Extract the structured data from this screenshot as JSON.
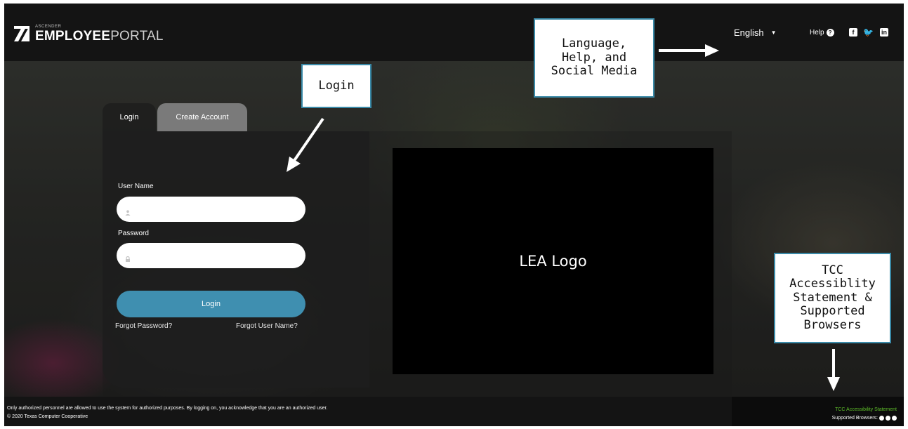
{
  "header": {
    "logo_small": "ASCENDER",
    "logo_bold": "EMPLOYEE",
    "logo_light": "PORTAL",
    "language": "English",
    "help": "Help",
    "social_icons": [
      "facebook-icon",
      "twitter-icon",
      "linkedin-icon"
    ]
  },
  "login": {
    "tabs": [
      "Login",
      "Create Account"
    ],
    "username_label": "User Name",
    "password_label": "Password",
    "username_value": "",
    "password_value": "",
    "button": "Login",
    "forgot_password": "Forgot Password?",
    "forgot_username": "Forgot User Name?"
  },
  "lea_logo": "LEA Logo",
  "footer": {
    "notice": "Only authorized personnel are allowed to use the system for authorized purposes. By logging on, you acknowledge that you are an authorized user.",
    "copyright": "© 2020 Texas Computer Cooperative",
    "tcc_statement": "TCC Accessibility Statement",
    "supported_browsers": "Supported Browsers:"
  },
  "callouts": {
    "login": "Login",
    "language": [
      "Language,",
      "Help, and",
      "Social Media"
    ],
    "tcc": [
      "TCC",
      "Accessiblity",
      "Statement &",
      "Supported",
      "Browsers"
    ]
  },
  "colors": {
    "header_bg": "#141414",
    "login_button": "#3f8fb0",
    "callout_border": "#3a8aa8",
    "tcc_link": "#5fbf2a"
  }
}
